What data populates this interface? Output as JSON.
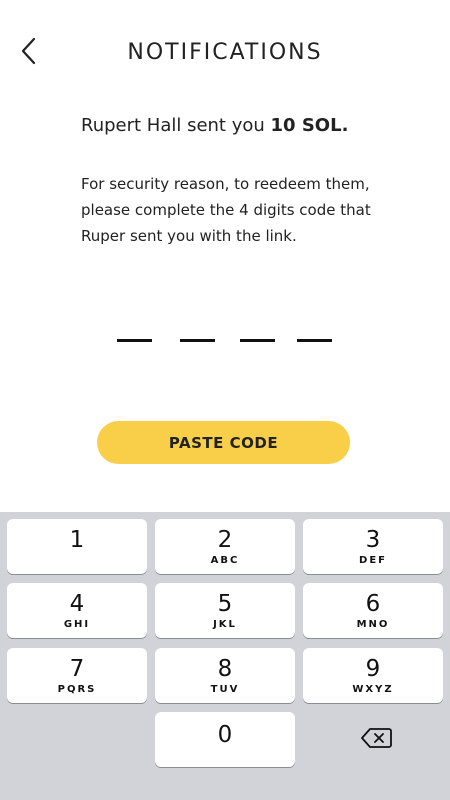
{
  "header": {
    "title": "NOTIFICATIONS",
    "back_icon": "chevron-left-icon"
  },
  "message": {
    "sender_prefix": "Rupert Hall sent you ",
    "amount": "10 SOL.",
    "instructions": "For security reason, to reedeem them, please complete the 4 digits code  that Ruper sent you with the link."
  },
  "code": {
    "digits": [
      "",
      "",
      "",
      ""
    ]
  },
  "paste_button": {
    "label": "PASTE CODE",
    "color": "#f9cf49"
  },
  "keypad": {
    "background": "#d1d3d9",
    "keys": [
      {
        "num": "1",
        "letters": ""
      },
      {
        "num": "2",
        "letters": "ABC"
      },
      {
        "num": "3",
        "letters": "DEF"
      },
      {
        "num": "4",
        "letters": "GHI"
      },
      {
        "num": "5",
        "letters": "JKL"
      },
      {
        "num": "6",
        "letters": "MNO"
      },
      {
        "num": "7",
        "letters": "PQRS"
      },
      {
        "num": "8",
        "letters": "TUV"
      },
      {
        "num": "9",
        "letters": "WXYZ"
      },
      {
        "num": "0",
        "letters": ""
      }
    ],
    "delete_icon": "backspace-icon"
  }
}
